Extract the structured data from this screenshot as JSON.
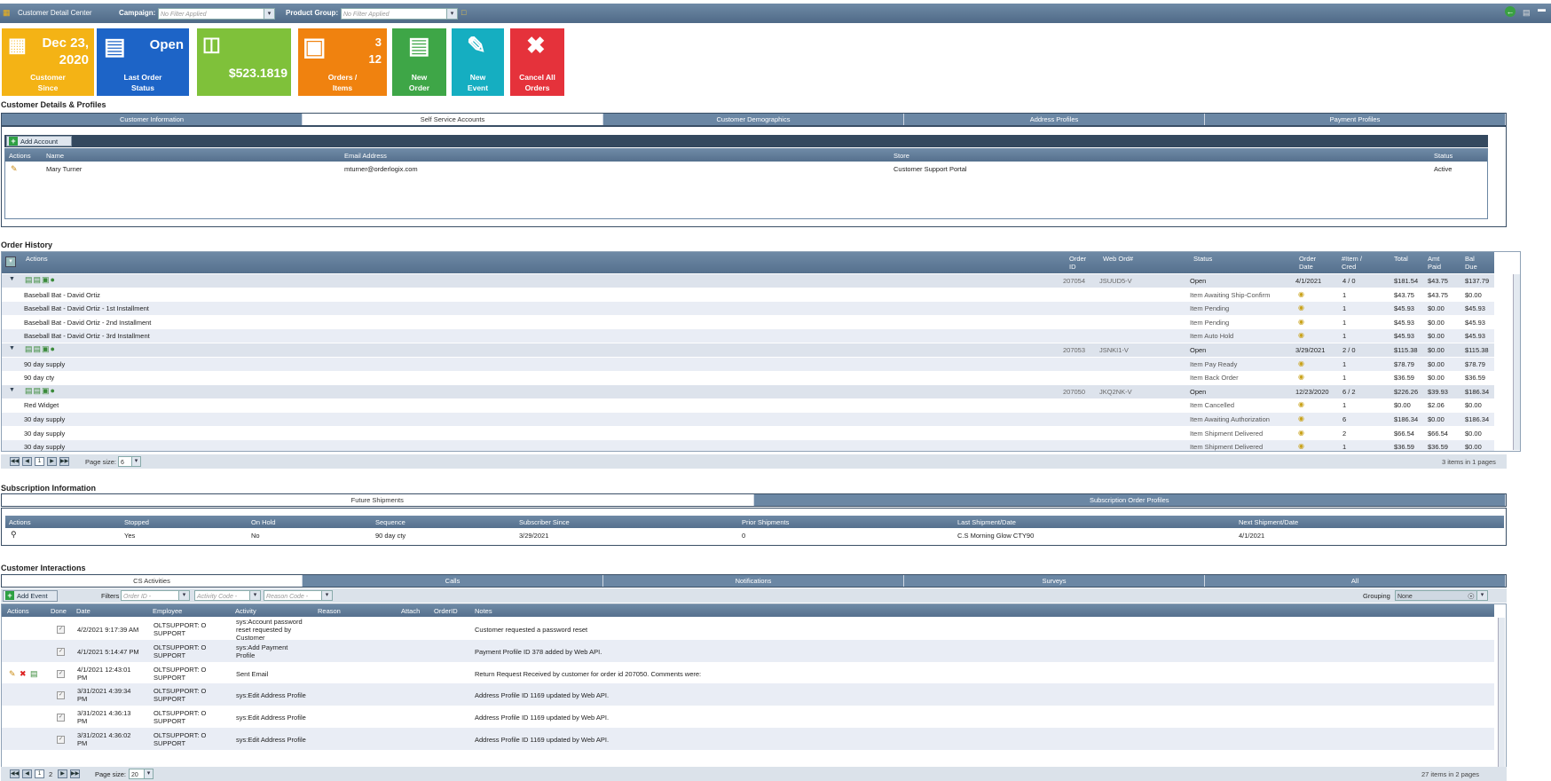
{
  "topbar": {
    "title": "Customer Detail Center",
    "campaign_label": "Campaign:",
    "campaign_value": "No Filter Applied",
    "product_group_label": "Product Group:",
    "product_group_value": "No Filter Applied"
  },
  "tiles": [
    {
      "value1": "Dec 23,",
      "value2": "2020",
      "label1": "Customer",
      "label2": "Since",
      "color": "#f4b315"
    },
    {
      "value1": "Open",
      "label1": "Last Order",
      "label2": "Status",
      "color": "#1d64c7"
    },
    {
      "value1": "$523.1819",
      "color": "#7fc13a"
    },
    {
      "value1": "3",
      "value2": "12",
      "label1": "Orders /",
      "label2": "Items",
      "color": "#f0820f"
    },
    {
      "label1": "New",
      "label2": "Order",
      "color": "#3ea647"
    },
    {
      "label1": "New",
      "label2": "Event",
      "color": "#15aec1"
    },
    {
      "label1": "Cancel All",
      "label2": "Orders",
      "color": "#e5323b"
    }
  ],
  "customer_details": {
    "title": "Customer Details & Profiles",
    "tabs": [
      "Customer Information",
      "Self Service Accounts",
      "Customer Demographics",
      "Address Profiles",
      "Payment Profiles"
    ],
    "add_account": "Add Account",
    "columns": [
      "Actions",
      "Name",
      "Email Address",
      "Store",
      "Status"
    ],
    "rows": [
      {
        "name": "Mary Turner",
        "email": "mturner@orderlogix.com",
        "store": "Customer Support Portal",
        "status": "Active"
      }
    ]
  },
  "order_history": {
    "title": "Order History",
    "columns": {
      "actions": "Actions",
      "order_id": "Order ID",
      "web_ord": "Web Ord#",
      "status": "Status",
      "order_date": "Order Date",
      "items": "#Item / Cred",
      "total": "Total",
      "amt_paid": "Amt Paid",
      "bal_due": "Bal Due"
    },
    "rows": [
      {
        "type": "group",
        "order_id": "207054",
        "web": "JSUUD5-V",
        "status": "Open",
        "date": "4/1/2021",
        "items": "4 / 0",
        "total": "$181.54",
        "paid": "$43.75",
        "bal": "$137.79"
      },
      {
        "type": "item",
        "name": "Baseball Bat - David Ortiz",
        "status": "Item Awaiting Ship-Confirm",
        "qty": "1",
        "total": "$43.75",
        "paid": "$43.75",
        "bal": "$0.00"
      },
      {
        "type": "item",
        "name": "Baseball Bat - David Ortiz - 1st Installment",
        "status": "Item Pending",
        "qty": "1",
        "total": "$45.93",
        "paid": "$0.00",
        "bal": "$45.93"
      },
      {
        "type": "item",
        "name": "Baseball Bat - David Ortiz - 2nd Installment",
        "status": "Item Pending",
        "qty": "1",
        "total": "$45.93",
        "paid": "$0.00",
        "bal": "$45.93"
      },
      {
        "type": "item",
        "name": "Baseball Bat - David Ortiz - 3rd Installment",
        "status": "Item Auto Hold",
        "qty": "1",
        "total": "$45.93",
        "paid": "$0.00",
        "bal": "$45.93"
      },
      {
        "type": "group",
        "order_id": "207053",
        "web": "JSNKI1-V",
        "status": "Open",
        "date": "3/29/2021",
        "items": "2 / 0",
        "total": "$115.38",
        "paid": "$0.00",
        "bal": "$115.38"
      },
      {
        "type": "item",
        "name": "90 day supply",
        "status": "Item Pay Ready",
        "qty": "1",
        "total": "$78.79",
        "paid": "$0.00",
        "bal": "$78.79"
      },
      {
        "type": "item",
        "name": "90 day cty",
        "status": "Item Back Order",
        "qty": "1",
        "total": "$36.59",
        "paid": "$0.00",
        "bal": "$36.59"
      },
      {
        "type": "group",
        "order_id": "207050",
        "web": "JKQ2NK-V",
        "status": "Open",
        "date": "12/23/2020",
        "items": "6 / 2",
        "total": "$226.26",
        "paid": "$39.93",
        "bal": "$186.34"
      },
      {
        "type": "item",
        "name": "Red Widget",
        "status": "Item Cancelled",
        "qty": "1",
        "total": "$0.00",
        "paid": "$2.06",
        "bal": "$0.00"
      },
      {
        "type": "item",
        "name": "30 day supply",
        "status": "Item Awaiting Authorization",
        "qty": "6",
        "total": "$186.34",
        "paid": "$0.00",
        "bal": "$186.34"
      },
      {
        "type": "item",
        "name": "30 day supply",
        "status": "Item Shipment Delivered",
        "qty": "2",
        "total": "$66.54",
        "paid": "$66.54",
        "bal": "$0.00"
      },
      {
        "type": "item",
        "name": "30 day supply",
        "status": "Item Shipment Delivered",
        "qty": "1",
        "total": "$36.59",
        "paid": "$36.59",
        "bal": "$0.00"
      }
    ],
    "page_size_label": "Page size:",
    "page_size": "6",
    "page_num": "1",
    "summary": "3 items in 1 pages"
  },
  "subscription": {
    "title": "Subscription Information",
    "tabs": [
      "Future Shipments",
      "Subscription Order Profiles"
    ],
    "columns": [
      "Actions",
      "Stopped",
      "On Hold",
      "Sequence",
      "Subscriber Since",
      "Prior Shipments",
      "Last Shipment/Date",
      "Next Shipment/Date"
    ],
    "row": [
      "",
      "Yes",
      "No",
      "90 day cty",
      "3/29/2021",
      "0",
      "C.S Morning Glow CTY90",
      "4/1/2021"
    ]
  },
  "interactions": {
    "title": "Customer Interactions",
    "tabs": [
      "CS Activities",
      "Calls",
      "Notifications",
      "Surveys",
      "All"
    ],
    "add_event": "Add Event",
    "filters_label": "Filters",
    "filter1": "Order ID -",
    "filter2": "Activity Code -",
    "filter3": "Reason Code -",
    "grouping_label": "Grouping",
    "grouping_value": "None",
    "columns": [
      "Actions",
      "Done",
      "Date",
      "Employee",
      "Activity",
      "Reason",
      "Attach",
      "OrderID",
      "Notes"
    ],
    "rows": [
      {
        "date": "4/2/2021 9:17:39 AM",
        "emp1": "OLTSUPPORT: O",
        "emp2": "SUPPORT",
        "act": [
          "sys:Account password",
          "reset requested by",
          "Customer"
        ],
        "notes": "Customer requested a password reset"
      },
      {
        "date": "4/1/2021 5:14:47 PM",
        "emp1": "OLTSUPPORT: O",
        "emp2": "SUPPORT",
        "act": [
          "sys:Add Payment",
          "Profile"
        ],
        "notes": "Payment Profile ID 378 added by Web API."
      },
      {
        "date": "4/1/2021 12:43:01",
        "date2": "PM",
        "emp1": "OLTSUPPORT: O",
        "emp2": "SUPPORT",
        "act": [
          "Sent Email"
        ],
        "notes": "Return Request Received by customer for order id 207050. Comments were:"
      },
      {
        "date": "3/31/2021 4:39:34",
        "date2": "PM",
        "emp1": "OLTSUPPORT: O",
        "emp2": "SUPPORT",
        "act": [
          "sys:Edit Address Profile"
        ],
        "notes": "Address Profile ID 1169 updated by Web API."
      },
      {
        "date": "3/31/2021 4:36:13",
        "date2": "PM",
        "emp1": "OLTSUPPORT: O",
        "emp2": "SUPPORT",
        "act": [
          "sys:Edit Address Profile"
        ],
        "notes": "Address Profile ID 1169 updated by Web API."
      },
      {
        "date": "3/31/2021 4:36:02",
        "date2": "PM",
        "emp1": "OLTSUPPORT: O",
        "emp2": "SUPPORT",
        "act": [
          "sys:Edit Address Profile"
        ],
        "notes": "Address Profile ID 1169 updated by Web API."
      }
    ],
    "page_size_label": "Page size:",
    "page_size": "20",
    "page1": "1",
    "page2": "2",
    "summary": "27 items in 2 pages"
  }
}
